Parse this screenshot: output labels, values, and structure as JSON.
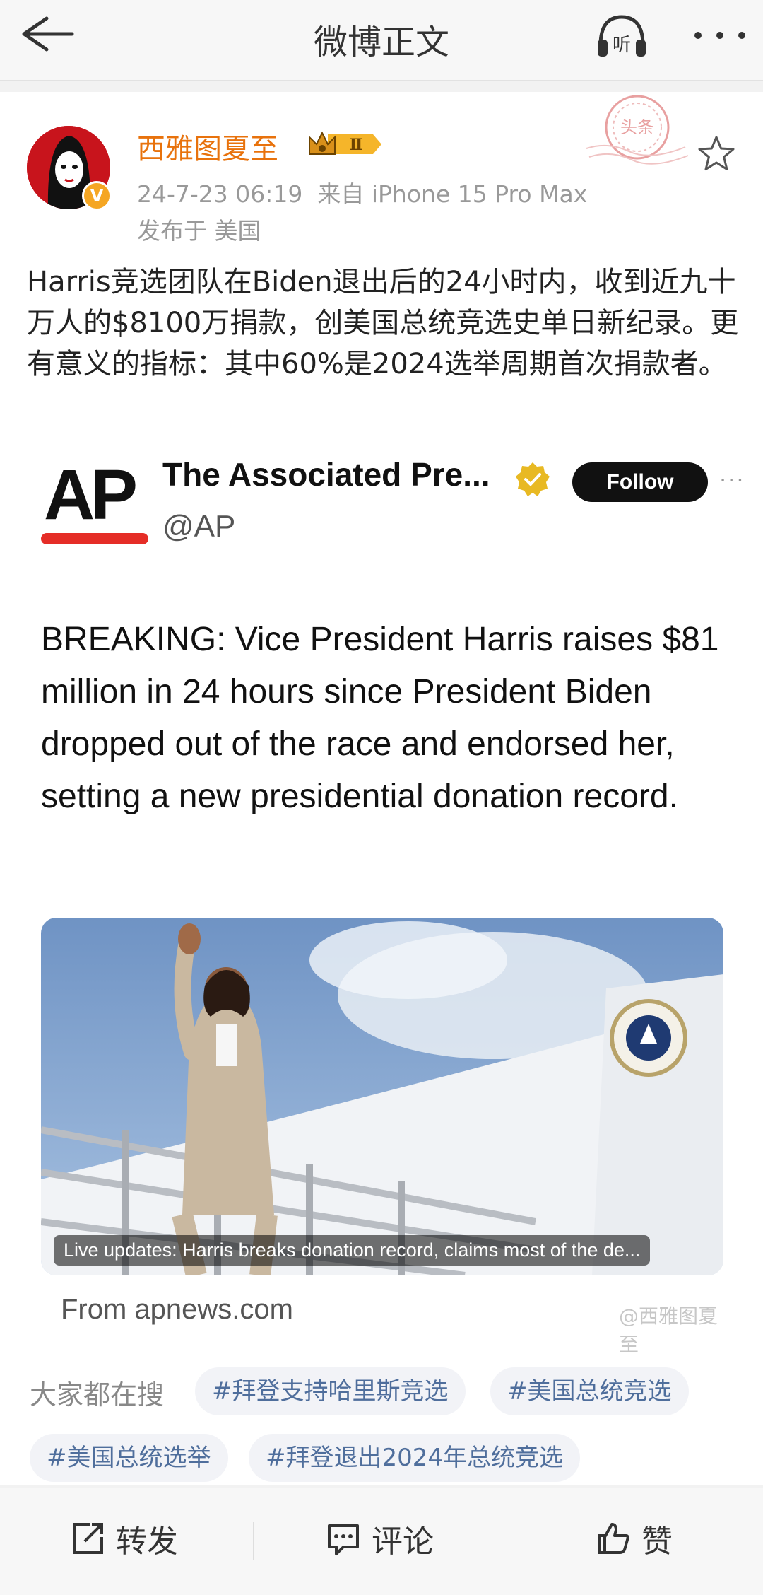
{
  "topbar": {
    "title": "微博正文",
    "listen_label": "听",
    "back_icon": "back-arrow-icon",
    "more_icon": "more-dots-icon"
  },
  "post": {
    "author": {
      "name": "西雅图夏至",
      "vip_badge": "Ⅱ",
      "verified_badge": "V"
    },
    "meta": {
      "time": "24-7-23 06:19",
      "source": "来自 iPhone 15 Pro Max",
      "location": "发布于 美国"
    },
    "stamp_text": "头条",
    "text": "Harris竞选团队在Biden退出后的24小时内，收到近九十万人的$8100万捐款，创美国总统竞选史单日新纪录。更有意义的指标：其中60%是2024选举周期首次捐款者。"
  },
  "embed": {
    "logo_text": "AP",
    "account_name": "The Associated Pre...",
    "handle": "@AP",
    "follow_label": "Follow",
    "more": "···",
    "headline": "BREAKING: Vice President Harris raises $81 million in 24 hours since President Biden dropped out of the race and endorsed her, setting a new presidential donation record.",
    "image_caption": "Live updates: Harris breaks donation record, claims most of the de...",
    "link_source": "From apnews.com",
    "watermark": "@西雅图夏至"
  },
  "search": {
    "label": "大家都在搜",
    "tags": [
      "#拜登支持哈里斯竞选",
      "#美国总统竞选",
      "#美国总统选举",
      "#拜登退出2024年总统竞选"
    ]
  },
  "bottombar": {
    "repost": "转发",
    "comment": "评论",
    "like": "赞"
  },
  "colors": {
    "username": "#e8720c",
    "tag_text": "#4f6e9c",
    "tag_bg": "#f2f3f7",
    "ap_red": "#e52d27",
    "avatar_red": "#c8141c",
    "vip_gold": "#f5a623"
  }
}
